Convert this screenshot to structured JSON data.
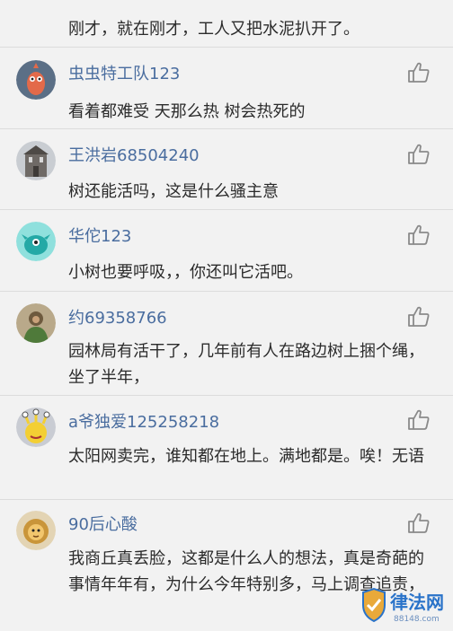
{
  "top_comment_tail": "刚才，就在刚才，工人又把水泥扒开了。",
  "comments": [
    {
      "user": "虫虫特工队123",
      "text": "看着都难受 天那么热 树会热死的",
      "avatar": "red-cartoon-bird-avatar"
    },
    {
      "user": "王洪岩68504240",
      "text": "树还能活吗，这是什么骚主意",
      "avatar": "building-photo-avatar"
    },
    {
      "user": "华佗123",
      "text": "小树也要呼吸，，你还叫它活吧。",
      "avatar": "teal-monster-avatar"
    },
    {
      "user": "约69358766",
      "text": "园林局有活干了，几年前有人在路边树上捆个绳，坐了半年，",
      "avatar": "painted-figure-avatar"
    },
    {
      "user": "a爷独爱125258218",
      "text": "太阳网卖完，谁知都在地上。满地都是。唉！无语",
      "avatar": "yellow-monster-avatar"
    },
    {
      "user": "90后心酸",
      "text": "我商丘真丢脸，这都是什么人的想法，真是奇葩的事情年年有，为什么今年特别多，马上调查追责，",
      "avatar": "lion-cartoon-avatar"
    }
  ],
  "watermark": {
    "name": "律法网",
    "url": "88148.com"
  },
  "colors": {
    "username": "#4a6d9f",
    "text": "#2b2b2b",
    "background": "#f2f2f2"
  }
}
